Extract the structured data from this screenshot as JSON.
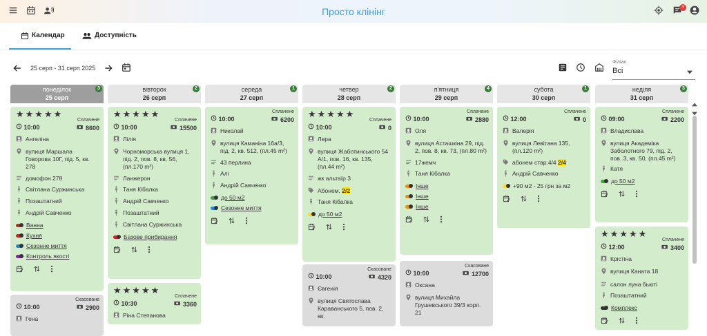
{
  "app": {
    "title": "Просто клінінг",
    "notif_count": "3"
  },
  "tabs": [
    {
      "label": "Календар"
    },
    {
      "label": "Доступність"
    }
  ],
  "datebar": {
    "range": "25 серп - 31 серп 2025",
    "filial_label": "Філіал",
    "filial_value": "Всі"
  },
  "days": [
    {
      "name": "понеділок",
      "date": "25 серп",
      "count": "3",
      "today": true,
      "cards": [
        {
          "status": "Сплачене",
          "stars": "★★★★★",
          "time": "10:00",
          "amount": "8600",
          "client": "Ангеліна",
          "address": "вулиця Маршала Говорова 10Г, під. 5, кв. 278",
          "note": "домофон 278",
          "staff": [
            "Світлана Суржинська",
            "Позаштатний",
            "Андрій Савченко"
          ],
          "extras": [
            {
              "label": "Ванна",
              "color": "#c62828"
            },
            {
              "label": "Кухня",
              "color": "#c62828"
            },
            {
              "label": "Сезонне миття",
              "color": "#1e88e5"
            },
            {
              "label": "Контроль якості",
              "color": "#8e24aa"
            }
          ]
        },
        {
          "status": "Скасоване",
          "stars": "",
          "time": "10:00",
          "amount": "2900",
          "client": "Гена"
        }
      ]
    },
    {
      "name": "вівторок",
      "date": "26 серп",
      "count": "2",
      "cards": [
        {
          "status": "Сплачене",
          "stars": "★★★★★",
          "time": "10:00",
          "amount": "15500",
          "client": "Лілія",
          "address": "Чорноморська вулиця 1, під. 2, пов. 8, кв. 56, (пл.170 m²)",
          "note": "Ланжерон",
          "staff": [
            "Таня Кібалка",
            "Андрій Савченко",
            "Позаштатний",
            "Світлана Суржинська"
          ],
          "extras": [
            {
              "label": "Базове прибирання",
              "color": "#c62828"
            }
          ]
        },
        {
          "status": "Сплачене",
          "stars": "★★★★★",
          "time": "10:30",
          "amount": "3360",
          "client": "Ріна Степанова"
        }
      ]
    },
    {
      "name": "середа",
      "date": "27 серп",
      "count": "1",
      "cards": [
        {
          "status": "Сплачене",
          "stars": "",
          "time": "10:00",
          "amount": "6200",
          "client": "Николай",
          "address": "вулиця Каманіна 16а/3, під. 2, кв. 512, (пл.45 m²)",
          "note": "43 перлина",
          "staff": [
            "Алі",
            "Андрій Савченко"
          ],
          "extras": [
            {
              "label": "до 50 м2",
              "color": "#43a047"
            },
            {
              "label": "Сезонне миття",
              "color": "#1e88e5"
            }
          ]
        }
      ]
    },
    {
      "name": "четвер",
      "date": "28 серп",
      "count": "2",
      "cards": [
        {
          "status": "Сплачене",
          "stars": "★★★★★",
          "time": "10:00",
          "amount": "0",
          "client": "Лера",
          "address": "вулиця Жаботинського 54 А/1, пов. 16, кв. 135, (пл.44 m²)",
          "note": "жк альтаїр 3",
          "tag": "Абонем. ",
          "tag_hl": "2/2",
          "staff": [
            "Таня Кібалка"
          ],
          "extras": [
            {
              "label": "до 50 м2",
              "color": "#fdd835"
            }
          ]
        },
        {
          "status": "Скасоване",
          "stars": "",
          "time": "10:00",
          "amount": "4320",
          "client": "Євгенія",
          "address": "вулиця Святослава Караванського 5, пов. 2, кв."
        }
      ]
    },
    {
      "name": "п'ятниця",
      "date": "29 серп",
      "count": "4",
      "cards": [
        {
          "status": "Сплачене",
          "stars": "",
          "time": "10:00",
          "amount": "2880",
          "client": "Оля",
          "address": "вулиця Асташкіна 29, під. 2, пов. 8, кв. 73, (пл.80 m²)",
          "note": "17жемч",
          "staff": [
            "Таня Кібалка"
          ],
          "extras": [
            {
              "label": "Інше",
              "color": "#fb8c00"
            },
            {
              "label": "Інше",
              "color": "#fb8c00"
            },
            {
              "label": "Інше",
              "color": "#fb8c00"
            }
          ]
        },
        {
          "status": "Скасоване",
          "stars": "",
          "time": "10:00",
          "amount": "12700",
          "client": "Оксана",
          "address": "вулиця Михайла Грушевського 39/3 корп. 21"
        }
      ]
    },
    {
      "name": "субота",
      "date": "30 серп",
      "count": "1",
      "cards": [
        {
          "status": "Сплачене",
          "stars": "",
          "time": "12:00",
          "amount": "0",
          "client": "Валерія",
          "address": "вулиця Левітана 135, (пл.120 m²)",
          "tag": "абонем стар.4/4 ",
          "tag_hl": "2/4",
          "staff": [
            "Андрій Савченко"
          ],
          "extras": [
            {
              "label": "+90 м2 - 25 грн за м2",
              "color": "#fdd835",
              "plain": true
            }
          ]
        }
      ]
    },
    {
      "name": "неділя",
      "date": "31 серп",
      "count": "3",
      "cards": [
        {
          "status": "Сплачене",
          "stars": "",
          "time": "09:00",
          "amount": "2200",
          "client": "Владислава",
          "address": "вулиця Академіка Заболотного 79, під. 2, пов. 3, кв. 50, (пл.45 m²)",
          "staff": [
            "Катя"
          ],
          "extras": [
            {
              "label": "до 50 м2",
              "color": "#43a047"
            }
          ]
        },
        {
          "status": "Сплачене",
          "stars": "★★★★★",
          "time": "12:00",
          "amount": "3400",
          "client": "Крістіна",
          "address": "вулиця Каната 18",
          "note": "салон луна бьюті",
          "staff": [
            "Позаштатний"
          ],
          "extras": [
            {
              "label": "Комплекс",
              "color": "#333"
            }
          ]
        }
      ]
    }
  ]
}
